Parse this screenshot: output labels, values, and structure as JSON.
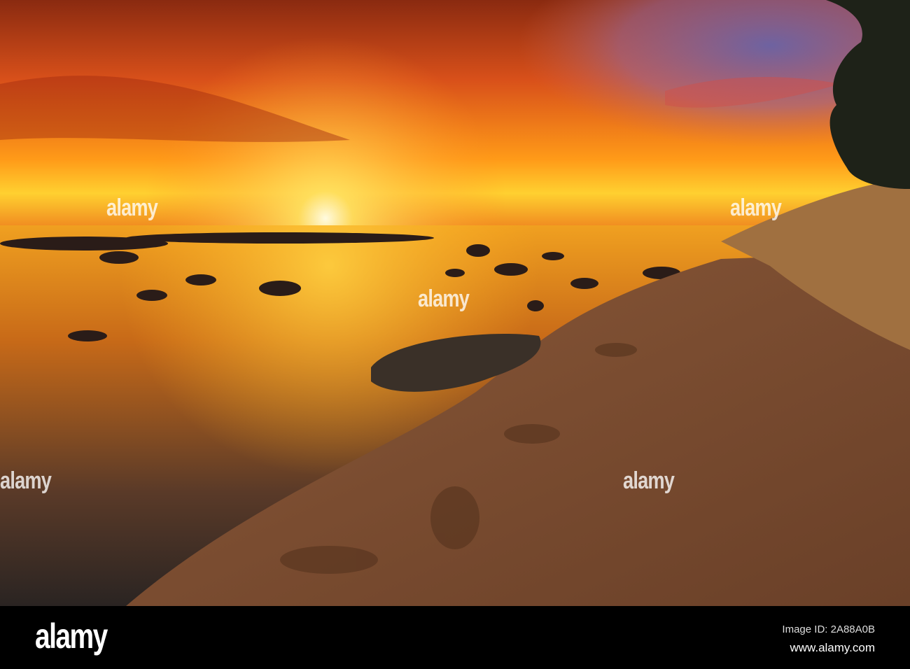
{
  "watermark": {
    "text": "alamy"
  },
  "footer": {
    "logo": "alamy",
    "image_id": "Image ID: 2A88A0B",
    "website": "www.alamy.com"
  }
}
